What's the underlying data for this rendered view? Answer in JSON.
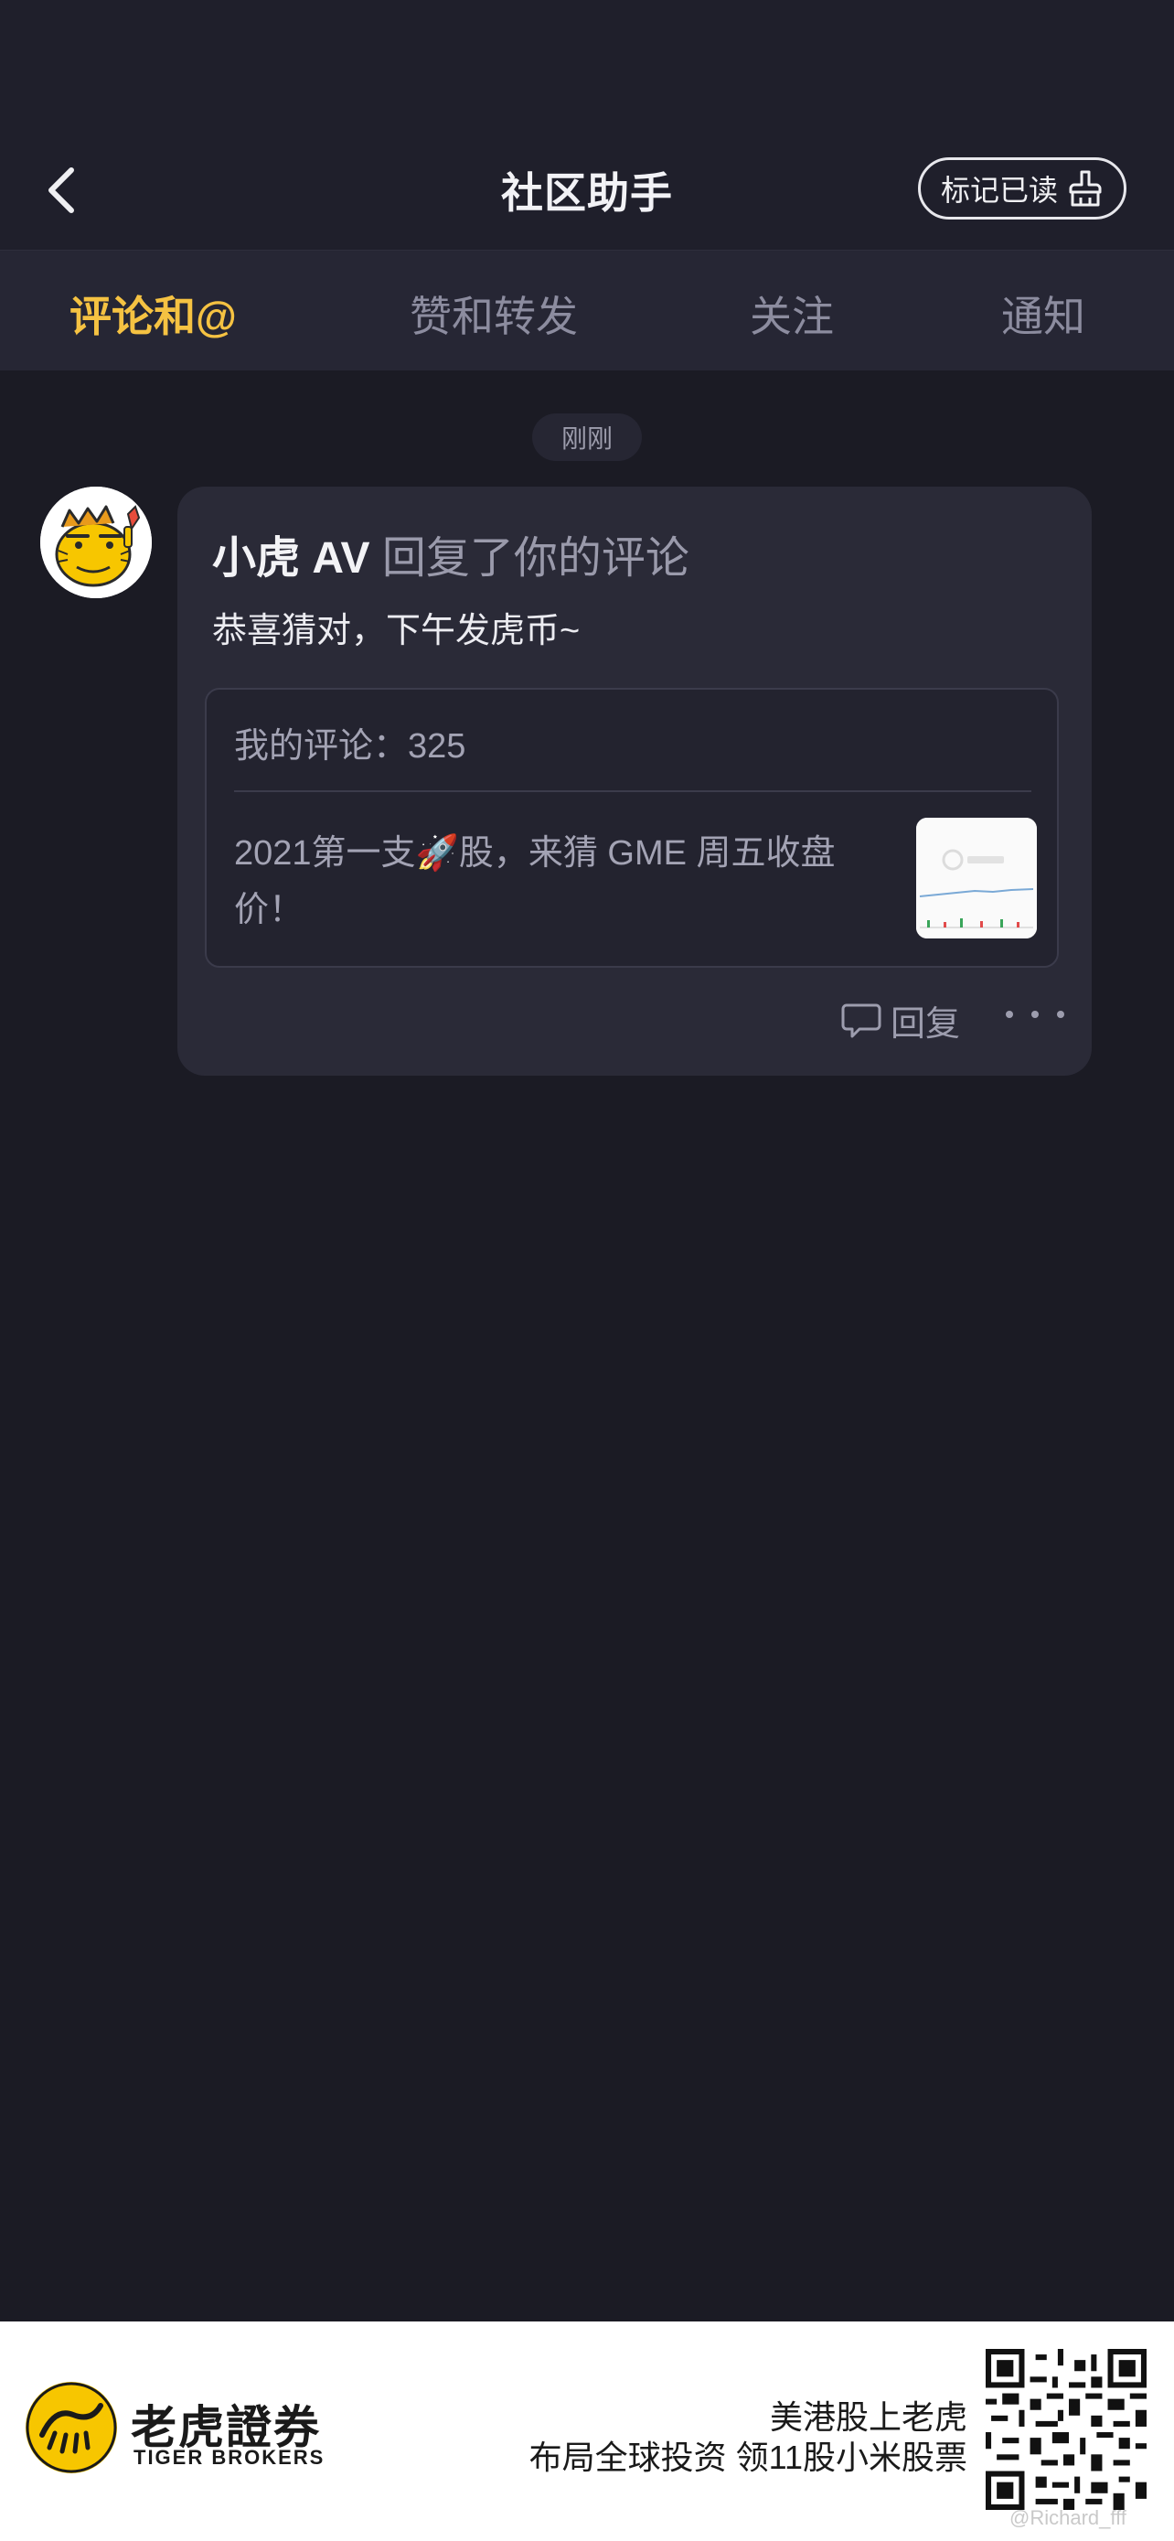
{
  "header": {
    "title": "社区助手",
    "mark_read_label": "标记已读"
  },
  "tabs": [
    {
      "label": "评论和@",
      "active": true
    },
    {
      "label": "赞和转发",
      "active": false
    },
    {
      "label": "关注",
      "active": false
    },
    {
      "label": "通知",
      "active": false
    }
  ],
  "feed": {
    "time_badge": "刚刚",
    "notification": {
      "sender": "小虎 AV",
      "action": "回复了你的评论",
      "reply_text": "恭喜猜对，下午发虎币~",
      "my_comment": "我的评论：325",
      "post_title": "2021第一支🚀股，来猜 GME 周五收盘价！",
      "reply_label": "回复"
    }
  },
  "footer": {
    "brand_cn": "老虎證券",
    "brand_en": "TIGER BROKERS",
    "promo_line1": "美港股上老虎",
    "promo_line2": "布局全球投资 领11股小米股票",
    "watermark": "@Richard_fff"
  },
  "colors": {
    "accent": "#f5c242",
    "background": "#1b1b24",
    "card": "#2a2a37"
  }
}
